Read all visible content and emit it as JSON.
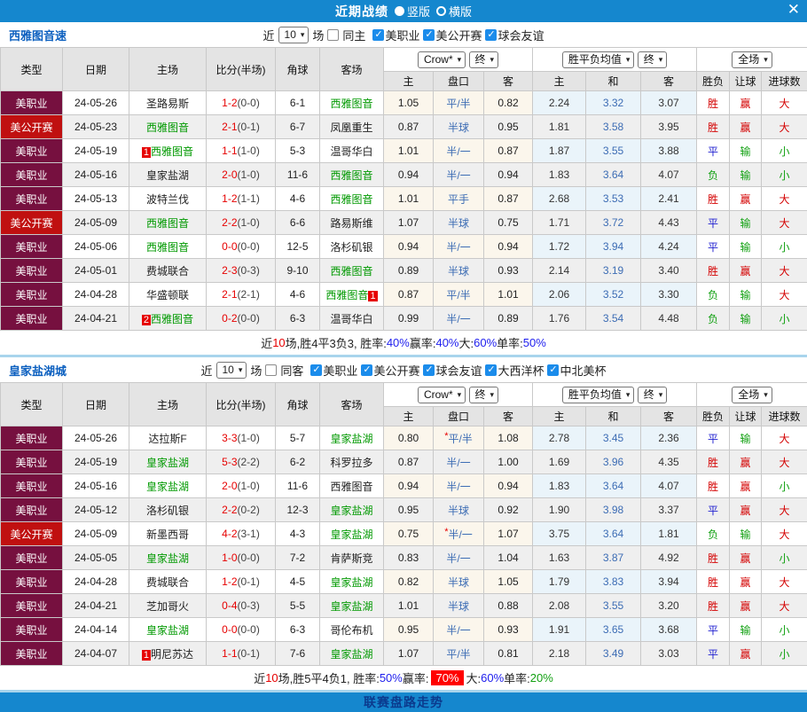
{
  "header": {
    "title": "近期战绩",
    "vertical": "竖版",
    "horizontal": "横版",
    "close": "✕"
  },
  "icons": {
    "caret": "▾",
    "check": "✓",
    "star": "*"
  },
  "dropdowns": {
    "bookmaker": "Crow*",
    "final": "终",
    "euro_avg": "胜平负均值",
    "scope": "全场"
  },
  "columns": {
    "left": [
      "类型",
      "日期",
      "主场",
      "比分(半场)",
      "角球",
      "客场"
    ],
    "asian": [
      "主",
      "盘口",
      "客"
    ],
    "euro": [
      "主",
      "和",
      "客"
    ],
    "result": [
      "胜负",
      "让球",
      "进球数"
    ]
  },
  "sections": [
    {
      "team": "西雅图音速",
      "filter": {
        "near": "近",
        "count": "10",
        "unit": "场",
        "same_label": "同主",
        "same_checked": false,
        "leagues": [
          "美职业",
          "美公开赛",
          "球会友谊"
        ]
      },
      "rows": [
        {
          "type": "美职业",
          "tc": "mls",
          "date": "24-05-26",
          "home": "圣路易斯",
          "hs": false,
          "hb": "",
          "score": "1-2",
          "half": "(0-0)",
          "corner": "6-1",
          "away": "西雅图音",
          "as": true,
          "ab": "",
          "ah": [
            "1.05",
            "平/半",
            "0.82"
          ],
          "star": false,
          "eu": [
            "2.24",
            "3.32",
            "3.07"
          ],
          "res": "胜",
          "rc": "w",
          "cov": "赢",
          "cc": "w",
          "gl": "大",
          "gc": "o"
        },
        {
          "type": "美公开赛",
          "tc": "usoc",
          "date": "24-05-23",
          "home": "西雅图音",
          "hs": true,
          "hb": "",
          "score": "2-1",
          "half": "(0-1)",
          "corner": "6-7",
          "away": "凤凰重生",
          "as": false,
          "ab": "",
          "ah": [
            "0.87",
            "半球",
            "0.95"
          ],
          "star": false,
          "eu": [
            "1.81",
            "3.58",
            "3.95"
          ],
          "res": "胜",
          "rc": "w",
          "cov": "赢",
          "cc": "w",
          "gl": "大",
          "gc": "o"
        },
        {
          "type": "美职业",
          "tc": "mls",
          "date": "24-05-19",
          "home": "西雅图音",
          "hs": true,
          "hb": "1",
          "score": "1-1",
          "half": "(1-0)",
          "corner": "5-3",
          "away": "温哥华白",
          "as": false,
          "ab": "",
          "ah": [
            "1.01",
            "半/一",
            "0.87"
          ],
          "star": false,
          "eu": [
            "1.87",
            "3.55",
            "3.88"
          ],
          "res": "平",
          "rc": "d",
          "cov": "输",
          "cc": "l",
          "gl": "小",
          "gc": "u"
        },
        {
          "type": "美职业",
          "tc": "mls",
          "date": "24-05-16",
          "home": "皇家盐湖",
          "hs": false,
          "hb": "",
          "score": "2-0",
          "half": "(1-0)",
          "corner": "11-6",
          "away": "西雅图音",
          "as": true,
          "ab": "",
          "ah": [
            "0.94",
            "半/一",
            "0.94"
          ],
          "star": false,
          "eu": [
            "1.83",
            "3.64",
            "4.07"
          ],
          "res": "负",
          "rc": "l",
          "cov": "输",
          "cc": "l",
          "gl": "小",
          "gc": "u"
        },
        {
          "type": "美职业",
          "tc": "mls",
          "date": "24-05-13",
          "home": "波特兰伐",
          "hs": false,
          "hb": "",
          "score": "1-2",
          "half": "(1-1)",
          "corner": "4-6",
          "away": "西雅图音",
          "as": true,
          "ab": "",
          "ah": [
            "1.01",
            "平手",
            "0.87"
          ],
          "star": false,
          "eu": [
            "2.68",
            "3.53",
            "2.41"
          ],
          "res": "胜",
          "rc": "w",
          "cov": "赢",
          "cc": "w",
          "gl": "大",
          "gc": "o"
        },
        {
          "type": "美公开赛",
          "tc": "usoc",
          "date": "24-05-09",
          "home": "西雅图音",
          "hs": true,
          "hb": "",
          "score": "2-2",
          "half": "(1-0)",
          "corner": "6-6",
          "away": "路易斯维",
          "as": false,
          "ab": "",
          "ah": [
            "1.07",
            "半球",
            "0.75"
          ],
          "star": false,
          "eu": [
            "1.71",
            "3.72",
            "4.43"
          ],
          "res": "平",
          "rc": "d",
          "cov": "输",
          "cc": "l",
          "gl": "大",
          "gc": "o"
        },
        {
          "type": "美职业",
          "tc": "mls",
          "date": "24-05-06",
          "home": "西雅图音",
          "hs": true,
          "hb": "",
          "score": "0-0",
          "half": "(0-0)",
          "corner": "12-5",
          "away": "洛杉矶银",
          "as": false,
          "ab": "",
          "ah": [
            "0.94",
            "半/一",
            "0.94"
          ],
          "star": false,
          "eu": [
            "1.72",
            "3.94",
            "4.24"
          ],
          "res": "平",
          "rc": "d",
          "cov": "输",
          "cc": "l",
          "gl": "小",
          "gc": "u"
        },
        {
          "type": "美职业",
          "tc": "mls",
          "date": "24-05-01",
          "home": "费城联合",
          "hs": false,
          "hb": "",
          "score": "2-3",
          "half": "(0-3)",
          "corner": "9-10",
          "away": "西雅图音",
          "as": true,
          "ab": "",
          "ah": [
            "0.89",
            "半球",
            "0.93"
          ],
          "star": false,
          "eu": [
            "2.14",
            "3.19",
            "3.40"
          ],
          "res": "胜",
          "rc": "w",
          "cov": "赢",
          "cc": "w",
          "gl": "大",
          "gc": "o"
        },
        {
          "type": "美职业",
          "tc": "mls",
          "date": "24-04-28",
          "home": "华盛顿联",
          "hs": false,
          "hb": "",
          "score": "2-1",
          "half": "(2-1)",
          "corner": "4-6",
          "away": "西雅图音",
          "as": true,
          "ab": "1",
          "ah": [
            "0.87",
            "平/半",
            "1.01"
          ],
          "star": false,
          "eu": [
            "2.06",
            "3.52",
            "3.30"
          ],
          "res": "负",
          "rc": "l",
          "cov": "输",
          "cc": "l",
          "gl": "大",
          "gc": "o"
        },
        {
          "type": "美职业",
          "tc": "mls",
          "date": "24-04-21",
          "home": "西雅图音",
          "hs": true,
          "hb": "2",
          "score": "0-2",
          "half": "(0-0)",
          "corner": "6-3",
          "away": "温哥华白",
          "as": false,
          "ab": "",
          "ah": [
            "0.99",
            "半/一",
            "0.89"
          ],
          "star": false,
          "eu": [
            "1.76",
            "3.54",
            "4.48"
          ],
          "res": "负",
          "rc": "l",
          "cov": "输",
          "cc": "l",
          "gl": "小",
          "gc": "u"
        }
      ],
      "summary": [
        {
          "t": "近",
          "c": "k"
        },
        {
          "t": "10",
          "c": "r"
        },
        {
          "t": "场,胜4平3负3, 胜率:",
          "c": "k"
        },
        {
          "t": "40%",
          "c": "b"
        },
        {
          "t": " 赢率:",
          "c": "k"
        },
        {
          "t": "40%",
          "c": "b"
        },
        {
          "t": " 大:",
          "c": "k"
        },
        {
          "t": "60%",
          "c": "b"
        },
        {
          "t": " 单率:",
          "c": "k"
        },
        {
          "t": "50%",
          "c": "b"
        }
      ]
    },
    {
      "team": "皇家盐湖城",
      "filter": {
        "near": "近",
        "count": "10",
        "unit": "场",
        "same_label": "同客",
        "same_checked": false,
        "leagues": [
          "美职业",
          "美公开赛",
          "球会友谊",
          "大西洋杯",
          "中北美杯"
        ]
      },
      "rows": [
        {
          "type": "美职业",
          "tc": "mls",
          "date": "24-05-26",
          "home": "达拉斯F",
          "hs": false,
          "hb": "",
          "score": "3-3",
          "half": "(1-0)",
          "corner": "5-7",
          "away": "皇家盐湖",
          "as": true,
          "ab": "",
          "ah": [
            "0.80",
            "平/半",
            "1.08"
          ],
          "star": true,
          "eu": [
            "2.78",
            "3.45",
            "2.36"
          ],
          "res": "平",
          "rc": "d",
          "cov": "输",
          "cc": "l",
          "gl": "大",
          "gc": "o"
        },
        {
          "type": "美职业",
          "tc": "mls",
          "date": "24-05-19",
          "home": "皇家盐湖",
          "hs": true,
          "hb": "",
          "score": "5-3",
          "half": "(2-2)",
          "corner": "6-2",
          "away": "科罗拉多",
          "as": false,
          "ab": "",
          "ah": [
            "0.87",
            "半/一",
            "1.00"
          ],
          "star": false,
          "eu": [
            "1.69",
            "3.96",
            "4.35"
          ],
          "res": "胜",
          "rc": "w",
          "cov": "赢",
          "cc": "w",
          "gl": "大",
          "gc": "o"
        },
        {
          "type": "美职业",
          "tc": "mls",
          "date": "24-05-16",
          "home": "皇家盐湖",
          "hs": true,
          "hb": "",
          "score": "2-0",
          "half": "(1-0)",
          "corner": "11-6",
          "away": "西雅图音",
          "as": false,
          "ab": "",
          "ah": [
            "0.94",
            "半/一",
            "0.94"
          ],
          "star": false,
          "eu": [
            "1.83",
            "3.64",
            "4.07"
          ],
          "res": "胜",
          "rc": "w",
          "cov": "赢",
          "cc": "w",
          "gl": "小",
          "gc": "u"
        },
        {
          "type": "美职业",
          "tc": "mls",
          "date": "24-05-12",
          "home": "洛杉矶银",
          "hs": false,
          "hb": "",
          "score": "2-2",
          "half": "(0-2)",
          "corner": "12-3",
          "away": "皇家盐湖",
          "as": true,
          "ab": "",
          "ah": [
            "0.95",
            "半球",
            "0.92"
          ],
          "star": false,
          "eu": [
            "1.90",
            "3.98",
            "3.37"
          ],
          "res": "平",
          "rc": "d",
          "cov": "赢",
          "cc": "w",
          "gl": "大",
          "gc": "o"
        },
        {
          "type": "美公开赛",
          "tc": "usoc",
          "date": "24-05-09",
          "home": "新墨西哥",
          "hs": false,
          "hb": "",
          "score": "4-2",
          "half": "(3-1)",
          "corner": "4-3",
          "away": "皇家盐湖",
          "as": true,
          "ab": "",
          "ah": [
            "0.75",
            "半/一",
            "1.07"
          ],
          "star": true,
          "eu": [
            "3.75",
            "3.64",
            "1.81"
          ],
          "res": "负",
          "rc": "l",
          "cov": "输",
          "cc": "l",
          "gl": "大",
          "gc": "o"
        },
        {
          "type": "美职业",
          "tc": "mls",
          "date": "24-05-05",
          "home": "皇家盐湖",
          "hs": true,
          "hb": "",
          "score": "1-0",
          "half": "(0-0)",
          "corner": "7-2",
          "away": "肯萨斯竞",
          "as": false,
          "ab": "",
          "ah": [
            "0.83",
            "半/一",
            "1.04"
          ],
          "star": false,
          "eu": [
            "1.63",
            "3.87",
            "4.92"
          ],
          "res": "胜",
          "rc": "w",
          "cov": "赢",
          "cc": "w",
          "gl": "小",
          "gc": "u"
        },
        {
          "type": "美职业",
          "tc": "mls",
          "date": "24-04-28",
          "home": "费城联合",
          "hs": false,
          "hb": "",
          "score": "1-2",
          "half": "(0-1)",
          "corner": "4-5",
          "away": "皇家盐湖",
          "as": true,
          "ab": "",
          "ah": [
            "0.82",
            "半球",
            "1.05"
          ],
          "star": false,
          "eu": [
            "1.79",
            "3.83",
            "3.94"
          ],
          "res": "胜",
          "rc": "w",
          "cov": "赢",
          "cc": "w",
          "gl": "大",
          "gc": "o"
        },
        {
          "type": "美职业",
          "tc": "mls",
          "date": "24-04-21",
          "home": "芝加哥火",
          "hs": false,
          "hb": "",
          "score": "0-4",
          "half": "(0-3)",
          "corner": "5-5",
          "away": "皇家盐湖",
          "as": true,
          "ab": "",
          "ah": [
            "1.01",
            "半球",
            "0.88"
          ],
          "star": false,
          "eu": [
            "2.08",
            "3.55",
            "3.20"
          ],
          "res": "胜",
          "rc": "w",
          "cov": "赢",
          "cc": "w",
          "gl": "大",
          "gc": "o"
        },
        {
          "type": "美职业",
          "tc": "mls",
          "date": "24-04-14",
          "home": "皇家盐湖",
          "hs": true,
          "hb": "",
          "score": "0-0",
          "half": "(0-0)",
          "corner": "6-3",
          "away": "哥伦布机",
          "as": false,
          "ab": "",
          "ah": [
            "0.95",
            "半/一",
            "0.93"
          ],
          "star": false,
          "eu": [
            "1.91",
            "3.65",
            "3.68"
          ],
          "res": "平",
          "rc": "d",
          "cov": "输",
          "cc": "l",
          "gl": "小",
          "gc": "u"
        },
        {
          "type": "美职业",
          "tc": "mls",
          "date": "24-04-07",
          "home": "明尼苏达",
          "hs": false,
          "hb": "1",
          "score": "1-1",
          "half": "(0-1)",
          "corner": "7-6",
          "away": "皇家盐湖",
          "as": true,
          "ab": "",
          "ah": [
            "1.07",
            "平/半",
            "0.81"
          ],
          "star": false,
          "eu": [
            "2.18",
            "3.49",
            "3.03"
          ],
          "res": "平",
          "rc": "d",
          "cov": "赢",
          "cc": "w",
          "gl": "小",
          "gc": "u"
        }
      ],
      "summary": [
        {
          "t": "近",
          "c": "k"
        },
        {
          "t": "10",
          "c": "r"
        },
        {
          "t": "场,胜5平4负1, 胜率:",
          "c": "k"
        },
        {
          "t": "50%",
          "c": "b"
        },
        {
          "t": " 赢率:",
          "c": "k"
        },
        {
          "t": "70%",
          "c": "hl"
        },
        {
          "t": " 大:",
          "c": "k"
        },
        {
          "t": "60%",
          "c": "b"
        },
        {
          "t": " 单率:",
          "c": "k"
        },
        {
          "t": "20%",
          "c": "g"
        }
      ]
    }
  ],
  "footer": {
    "label": "联赛盘路走势"
  },
  "colors": {
    "bar_blue": "#1587CE",
    "mls_badge": "#76103F",
    "usoc_badge": "#C01010",
    "self_team_green": "#009900",
    "score_red": "#E60000",
    "handicap_blue": "#3C6CB4",
    "win_red": "#D40000",
    "draw_blue": "#2020D0",
    "lose_green": "#11A011",
    "highlight_bg": "#FF0000"
  }
}
